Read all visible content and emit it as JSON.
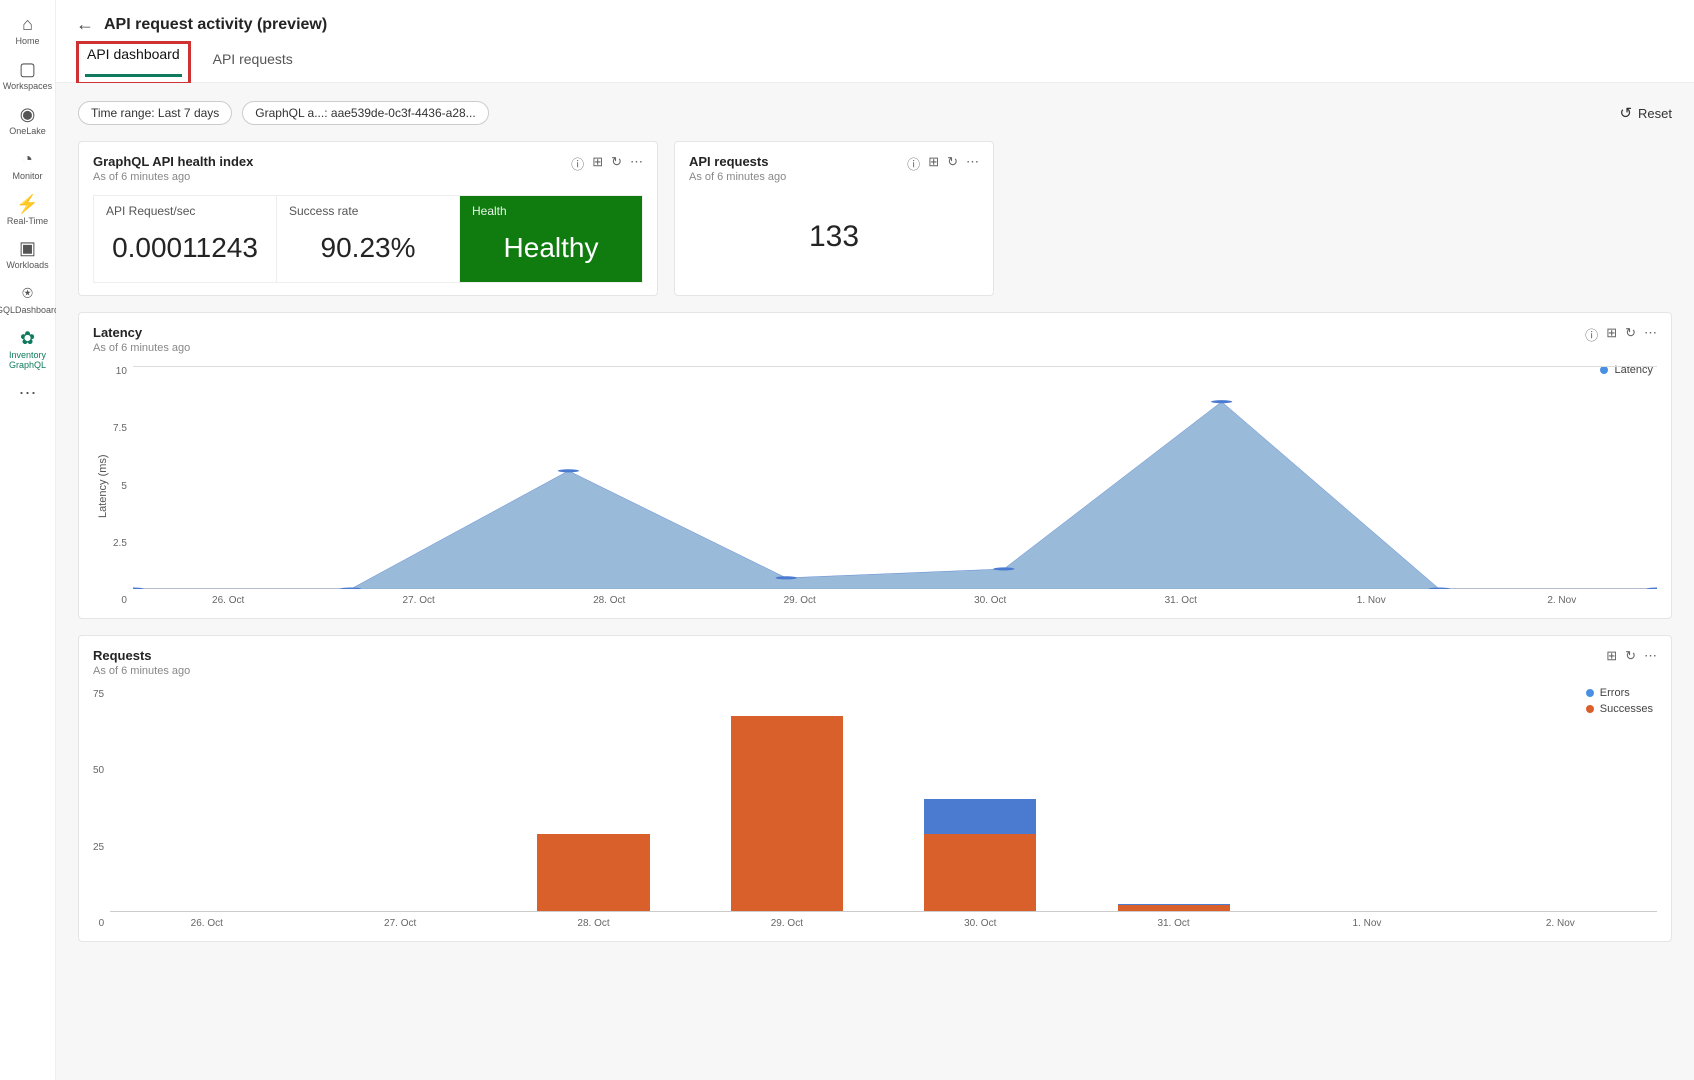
{
  "sidebar": {
    "items": [
      {
        "icon": "⌂",
        "label": "Home"
      },
      {
        "icon": "▢",
        "label": "Workspaces"
      },
      {
        "icon": "◉",
        "label": "OneLake"
      },
      {
        "icon": "◔",
        "label": "Monitor"
      },
      {
        "icon": "⚡",
        "label": "Real-Time"
      },
      {
        "icon": "▣",
        "label": "Workloads"
      },
      {
        "icon": "⍟",
        "label": "GQLDashboard"
      },
      {
        "icon": "✿",
        "label": "Inventory GraphQL"
      },
      {
        "icon": "⋯",
        "label": ""
      }
    ]
  },
  "page": {
    "title": "API request activity (preview)"
  },
  "tabs": {
    "active": "API dashboard",
    "other": "API requests"
  },
  "pills": {
    "time_range": "Time range: Last 7 days",
    "graphql": "GraphQL a...: aae539de-0c3f-4436-a28..."
  },
  "reset_label": "Reset",
  "cards": {
    "health": {
      "title": "GraphQL API health index",
      "asof": "As of 6 minutes ago",
      "req_rate_label": "API Request/sec",
      "req_rate_value": "0.00011243",
      "success_label": "Success rate",
      "success_value": "90.23%",
      "health_label": "Health",
      "health_value": "Healthy"
    },
    "api_req": {
      "title": "API requests",
      "asof": "As of 6 minutes ago",
      "value": "133"
    },
    "latency": {
      "title": "Latency",
      "asof": "As of 6 minutes ago",
      "legend": "Latency",
      "ylabel": "Latency (ms)"
    },
    "requests": {
      "title": "Requests",
      "asof": "As of 6 minutes ago",
      "legend_err": "Errors",
      "legend_suc": "Successes"
    }
  },
  "chart_data": [
    {
      "id": "latency",
      "type": "area",
      "title": "Latency",
      "xlabel": "",
      "ylabel": "Latency (ms)",
      "ylim": [
        0,
        10
      ],
      "y_ticks": [
        "10",
        "7.5",
        "5",
        "2.5",
        "0"
      ],
      "categories": [
        "26. Oct",
        "27. Oct",
        "28. Oct",
        "29. Oct",
        "30. Oct",
        "31. Oct",
        "1. Nov",
        "2. Nov"
      ],
      "series": [
        {
          "name": "Latency",
          "color": "#88aed4",
          "values": [
            0,
            0,
            5.3,
            0.5,
            0.9,
            8.4,
            0,
            0
          ]
        }
      ]
    },
    {
      "id": "requests",
      "type": "bar",
      "title": "Requests",
      "xlabel": "",
      "ylabel": "",
      "ylim": [
        0,
        75
      ],
      "y_ticks": [
        "75",
        "50",
        "25",
        "0"
      ],
      "categories": [
        "26. Oct",
        "27. Oct",
        "28. Oct",
        "29. Oct",
        "30. Oct",
        "31. Oct",
        "1. Nov",
        "2. Nov"
      ],
      "series": [
        {
          "name": "Errors",
          "color": "#4a7bd1",
          "values": [
            0,
            0,
            0,
            0,
            12,
            0.5,
            0,
            0
          ]
        },
        {
          "name": "Successes",
          "color": "#d95f2b",
          "values": [
            0,
            0,
            26,
            66,
            26,
            2,
            0,
            0
          ]
        }
      ]
    }
  ]
}
